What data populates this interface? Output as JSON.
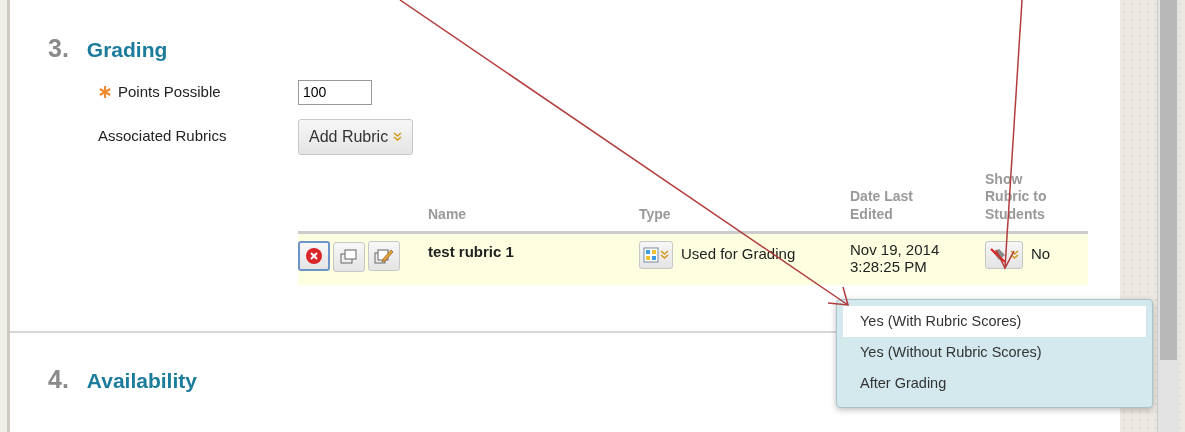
{
  "grading": {
    "number": "3.",
    "title": "Grading",
    "fields": [
      {
        "kind": "text",
        "label": "Points Possible",
        "required": true,
        "value": "100"
      },
      {
        "kind": "menu_button",
        "label": "Associated Rubrics",
        "required": false,
        "button": "Add Rubric"
      }
    ]
  },
  "rubric_table": {
    "columns": [
      "Name",
      "Type",
      "Date Last Edited",
      "Show Rubric to Students"
    ],
    "rows": [
      {
        "name": "test rubric 1",
        "type": "Used for Grading",
        "date": "Nov 19, 2014 3:28:25 PM",
        "show": "No",
        "selected": true
      }
    ]
  },
  "show_menu": {
    "items": [
      {
        "label": "Yes (With Rubric Scores)",
        "selected": true
      },
      {
        "label": "Yes (Without Rubric Scores)",
        "selected": false
      },
      {
        "label": "After Grading",
        "selected": false
      }
    ]
  },
  "next_section": {
    "number": "4.",
    "title": "Availability"
  }
}
